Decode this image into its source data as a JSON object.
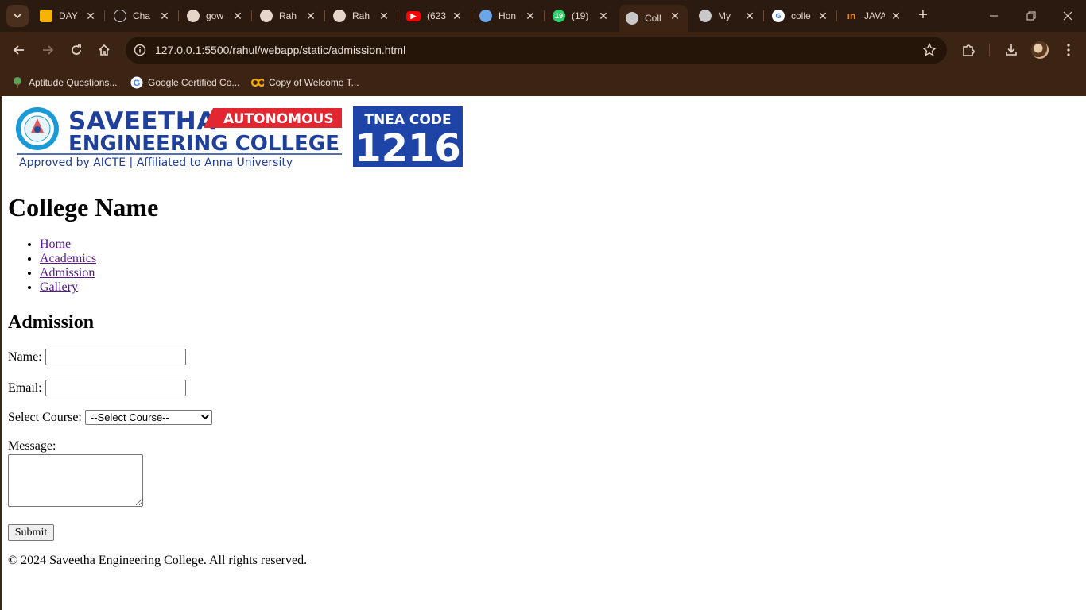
{
  "browser": {
    "tabs": [
      {
        "title": "DAY",
        "favicon": "slides-icon",
        "color": "#f5b400"
      },
      {
        "title": "Cha",
        "favicon": "chatgpt-icon",
        "color": "#cfcfcf"
      },
      {
        "title": "gow",
        "favicon": "github-icon",
        "color": "#e6d6ca"
      },
      {
        "title": "Rah",
        "favicon": "github-icon",
        "color": "#e6d6ca"
      },
      {
        "title": "Rah",
        "favicon": "github-icon",
        "color": "#e6d6ca"
      },
      {
        "title": "(623",
        "favicon": "youtube-icon",
        "color": "#ff0000"
      },
      {
        "title": "Hon",
        "favicon": "site-icon",
        "color": "#6aa7e8"
      },
      {
        "title": "(19)",
        "favicon": "whatsapp-icon",
        "color": "#25d366",
        "badge": "19"
      },
      {
        "title": "Coll",
        "favicon": "globe-icon",
        "color": "#c8c8c8",
        "active": true
      },
      {
        "title": "My",
        "favicon": "globe-icon",
        "color": "#c8c8c8"
      },
      {
        "title": "colle",
        "favicon": "google-icon",
        "color": "#4285f4"
      },
      {
        "title": "JAVA",
        "favicon": "javatpoint-icon",
        "color": "#f0881f"
      }
    ],
    "url": "127.0.0.1:5500/rahul/webapp/static/admission.html",
    "bookmarks": [
      {
        "label": "Aptitude Questions...",
        "icon": "tree-icon"
      },
      {
        "label": "Google Certified Co...",
        "icon": "google-icon"
      },
      {
        "label": "Copy of Welcome T...",
        "icon": "colab-icon"
      }
    ]
  },
  "page": {
    "logo": {
      "line1": "SAVEETHA",
      "badge": "AUTONOMOUS",
      "line2": "ENGINEERING COLLEGE",
      "line3": "Approved by AICTE  |  Affiliated to Anna University",
      "code_label": "TNEA CODE",
      "code": "1216"
    },
    "title": "College Name",
    "nav": [
      "Home",
      "Academics",
      "Admission",
      "Gallery"
    ],
    "section_title": "Admission",
    "form": {
      "name_label": "Name:",
      "email_label": "Email:",
      "course_label": "Select Course:",
      "course_selected": "--Select Course--",
      "message_label": "Message:",
      "submit_label": "Submit"
    },
    "footer": "© 2024 Saveetha Engineering College. All rights reserved."
  }
}
